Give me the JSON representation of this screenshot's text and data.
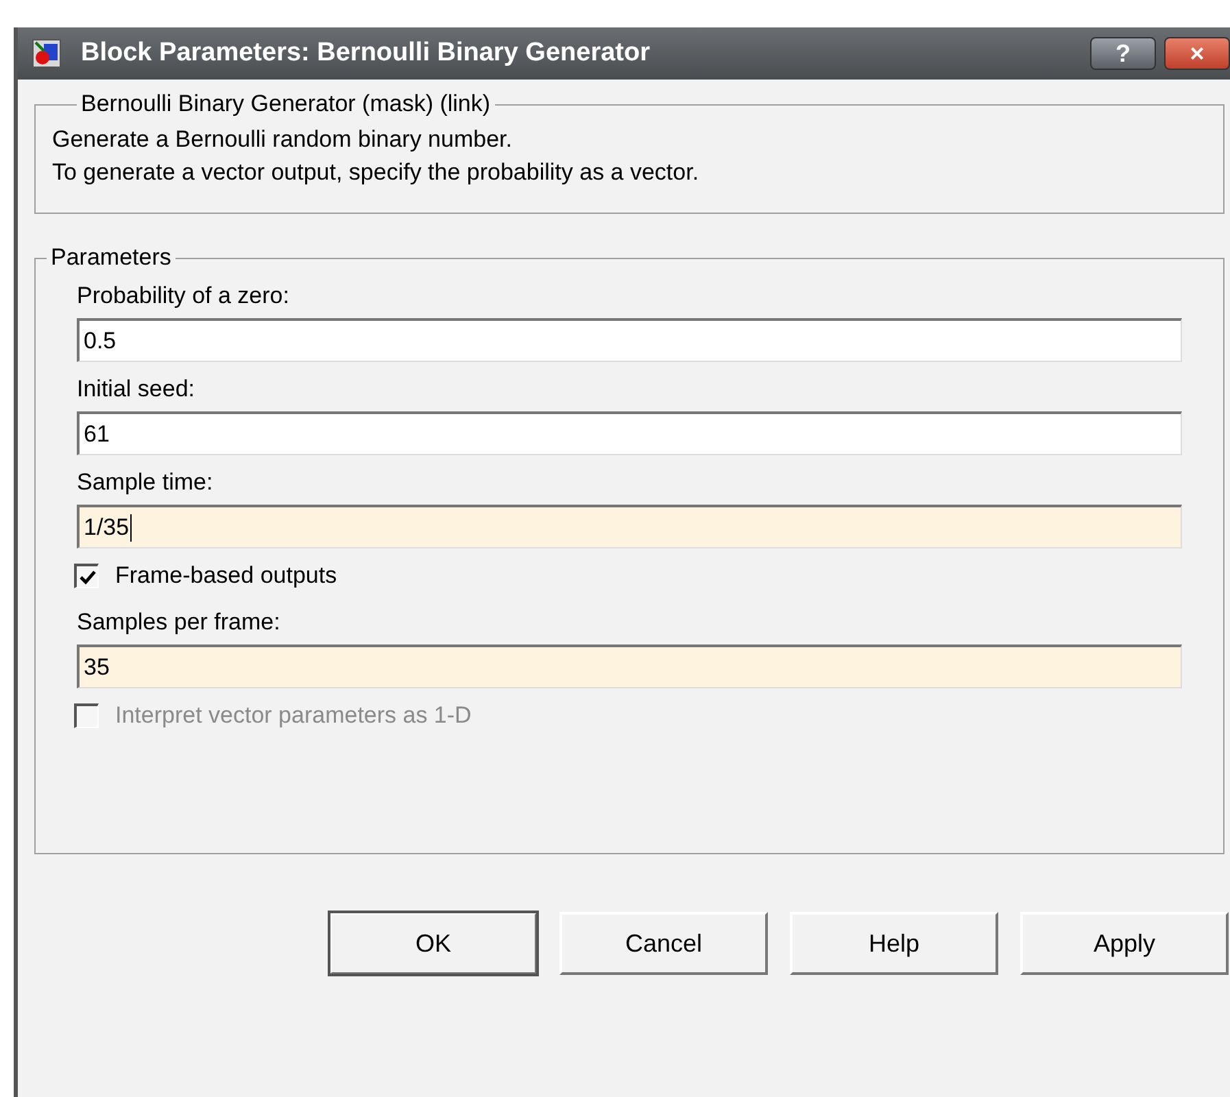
{
  "window": {
    "title": "Block Parameters: Bernoulli Binary Generator",
    "help_button": "?",
    "close_button": "×"
  },
  "description_group": {
    "title": "Bernoulli Binary Generator (mask) (link)",
    "lines": [
      "Generate a Bernoulli random binary number.",
      "To generate a vector output, specify the probability as a vector."
    ]
  },
  "parameters_group": {
    "title": "Parameters",
    "items": [
      {
        "kind": "field",
        "label": "Probability of a zero:",
        "value": "0.5",
        "modified": false,
        "focused": false
      },
      {
        "kind": "field",
        "label": "Initial seed:",
        "value": "61",
        "modified": false,
        "focused": false
      },
      {
        "kind": "field",
        "label": "Sample time:",
        "value": "1/35",
        "modified": true,
        "focused": true
      },
      {
        "kind": "checkbox",
        "label": "Frame-based outputs",
        "checked": true,
        "disabled": false
      },
      {
        "kind": "field",
        "label": "Samples per frame:",
        "value": "35",
        "modified": true,
        "focused": false
      },
      {
        "kind": "checkbox",
        "label": "Interpret vector parameters as 1-D",
        "checked": false,
        "disabled": true
      }
    ]
  },
  "buttons": [
    {
      "label": "OK",
      "default": true
    },
    {
      "label": "Cancel",
      "default": false
    },
    {
      "label": "Help",
      "default": false
    },
    {
      "label": "Apply",
      "default": false
    }
  ]
}
